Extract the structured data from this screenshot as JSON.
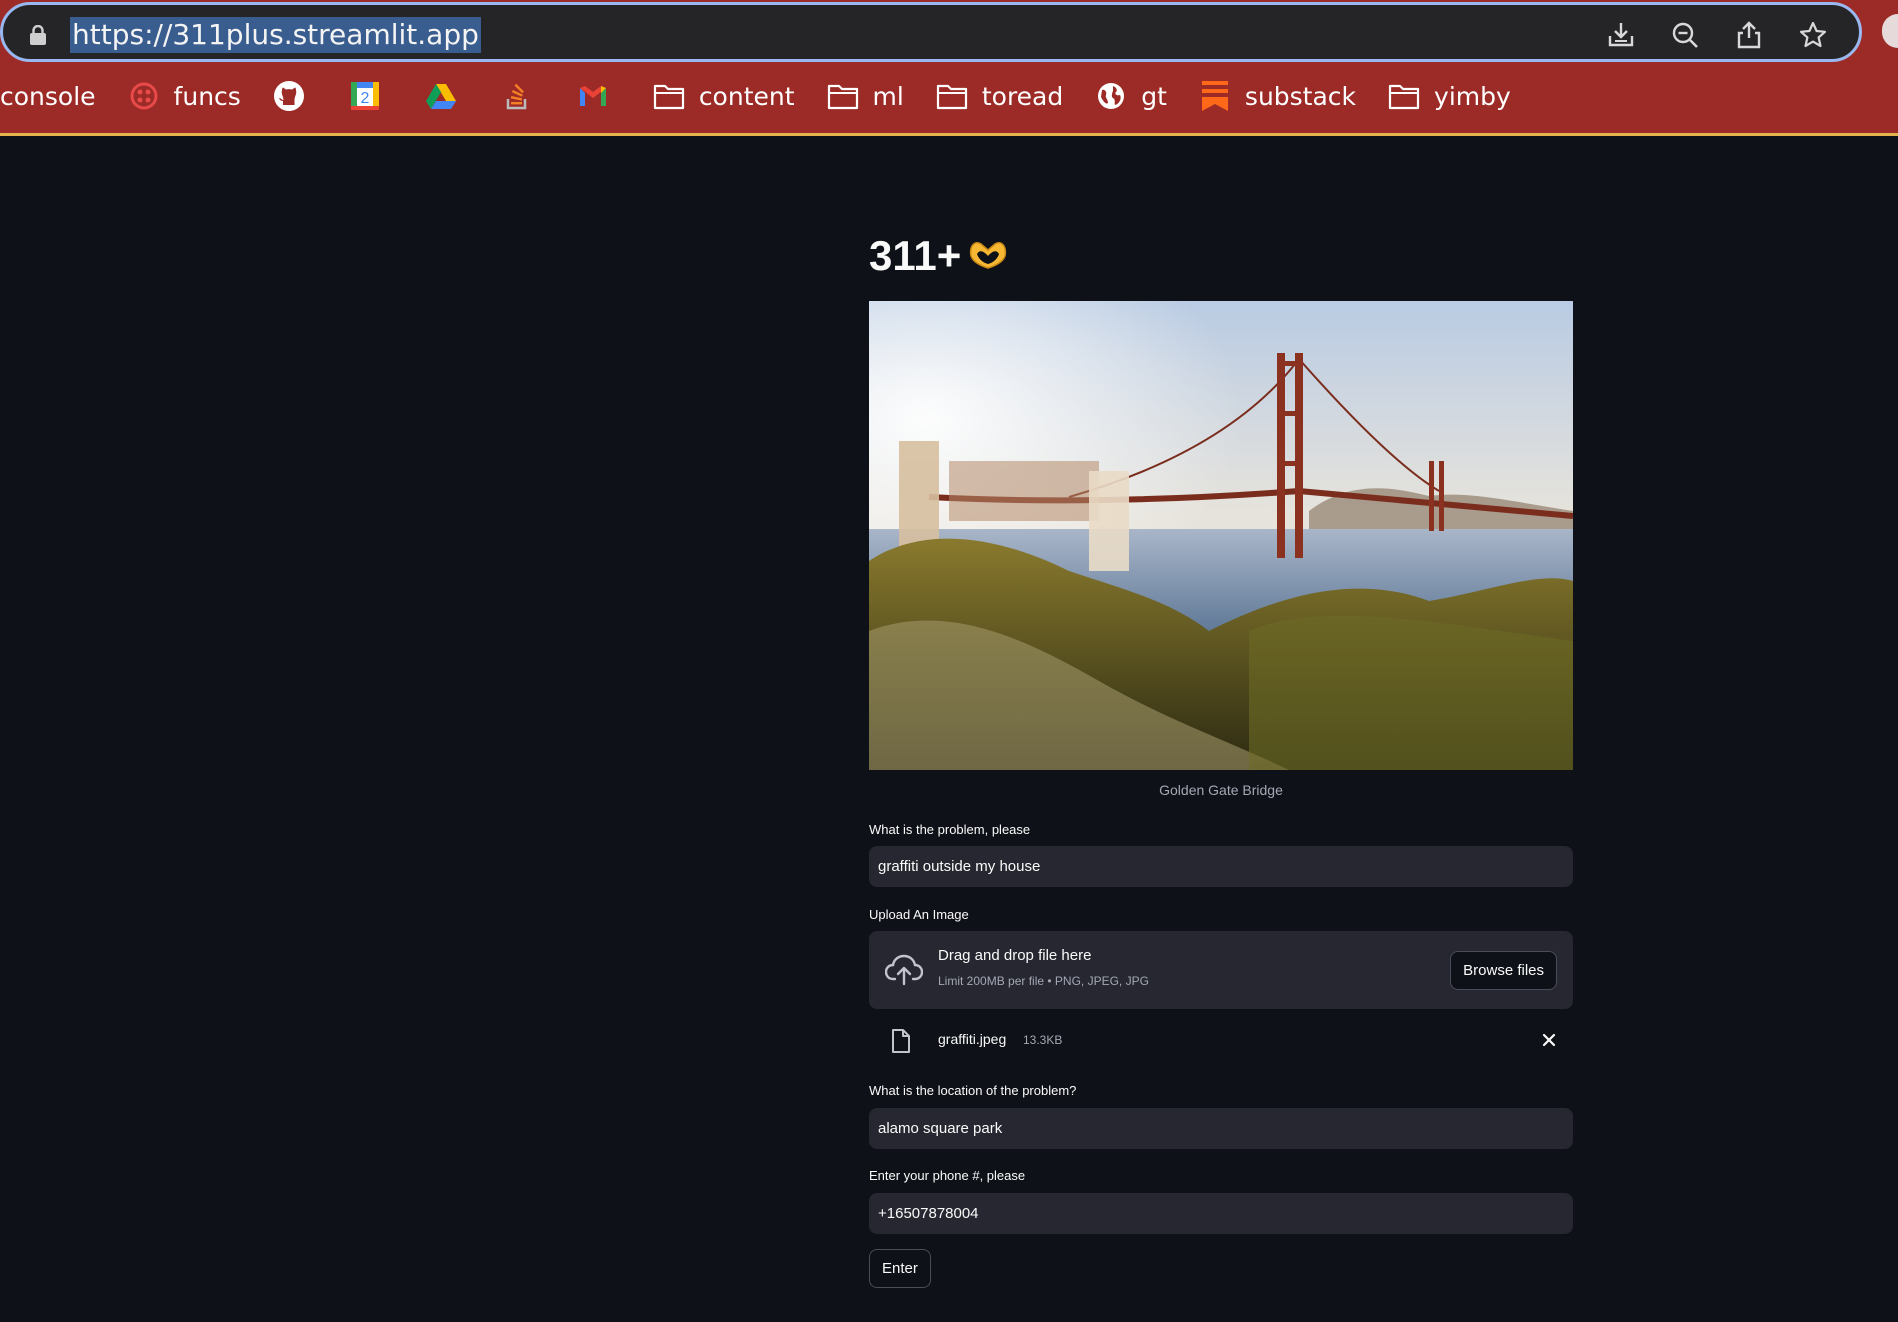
{
  "browser": {
    "url": "https://311plus.streamlit.app",
    "toolbar_icons": [
      "download-icon",
      "zoom-icon",
      "share-icon",
      "bookmark-star-icon"
    ],
    "bookmarks": [
      {
        "label": "console",
        "icon": "none"
      },
      {
        "label": "funcs",
        "icon": "twilio-icon"
      },
      {
        "label": "",
        "icon": "github-icon"
      },
      {
        "label": "",
        "icon": "calendar-icon"
      },
      {
        "label": "",
        "icon": "drive-icon"
      },
      {
        "label": "",
        "icon": "stackoverflow-icon"
      },
      {
        "label": "",
        "icon": "gmail-icon"
      },
      {
        "label": "content",
        "icon": "folder-icon"
      },
      {
        "label": "ml",
        "icon": "folder-icon"
      },
      {
        "label": "toread",
        "icon": "folder-icon"
      },
      {
        "label": "gt",
        "icon": "globe-icon"
      },
      {
        "label": "substack",
        "icon": "substack-icon"
      },
      {
        "label": "yimby",
        "icon": "folder-icon"
      }
    ],
    "chrome_color": "#9c2b27"
  },
  "app": {
    "title": "311+",
    "title_emoji": "heart-hands-icon",
    "image_caption": "Golden Gate Bridge",
    "problem": {
      "label": "What is the problem, please",
      "value": "graffiti outside my house"
    },
    "upload": {
      "label": "Upload An Image",
      "dropzone_title": "Drag and drop file here",
      "dropzone_hint": "Limit 200MB per file • PNG, JPEG, JPG",
      "browse_label": "Browse files",
      "file_name": "graffiti.jpeg",
      "file_size": "13.3KB"
    },
    "location": {
      "label": "What is the location of the problem?",
      "value": "alamo square park"
    },
    "phone": {
      "label": "Enter your phone #, please",
      "value": "+16507878004"
    },
    "submit_label": "Enter"
  }
}
